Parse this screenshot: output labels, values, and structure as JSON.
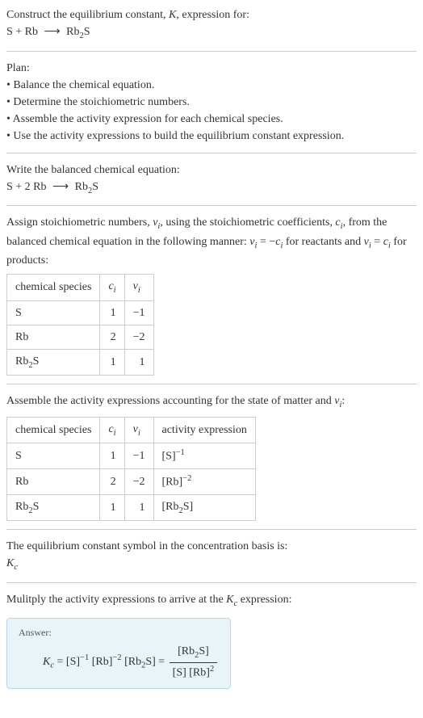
{
  "intro": {
    "line1_prefix": "Construct the equilibrium constant, ",
    "line1_K": "K",
    "line1_suffix": ", expression for:",
    "equation_lhs": "S + Rb",
    "arrow": "⟶",
    "equation_rhs1": "Rb",
    "equation_rhs_sub": "2",
    "equation_rhs2": "S"
  },
  "plan": {
    "title": "Plan:",
    "b1": "• Balance the chemical equation.",
    "b2": "• Determine the stoichiometric numbers.",
    "b3": "• Assemble the activity expression for each chemical species.",
    "b4": "• Use the activity expressions to build the equilibrium constant expression."
  },
  "balanced": {
    "title": "Write the balanced chemical equation:",
    "lhs": "S + 2 Rb",
    "arrow": "⟶",
    "rhs1": "Rb",
    "rhs_sub": "2",
    "rhs2": "S"
  },
  "stoich_text": {
    "p1": "Assign stoichiometric numbers, ",
    "nu": "ν",
    "i": "i",
    "p2": ", using the stoichiometric coefficients, ",
    "c": "c",
    "p3": ", from the balanced chemical equation in the following manner: ",
    "eq_reactants_lhs": "ν",
    "eq_eq": " = −",
    "eq_reactants_c": "c",
    "p4": " for reactants and ",
    "eq_products_lhs": "ν",
    "eq_products_eq": " = ",
    "eq_products_c": "c",
    "p5": " for products:"
  },
  "table1": {
    "h1": "chemical species",
    "h2_c": "c",
    "h2_i": "i",
    "h3_nu": "ν",
    "h3_i": "i",
    "rows": [
      {
        "species": "S",
        "sub": "",
        "c": "1",
        "nu": "−1"
      },
      {
        "species": "Rb",
        "sub": "",
        "c": "2",
        "nu": "−2"
      },
      {
        "species": "Rb",
        "sub": "2",
        "species2": "S",
        "c": "1",
        "nu": "1"
      }
    ]
  },
  "activity_text": {
    "p1": "Assemble the activity expressions accounting for the state of matter and ",
    "nu": "ν",
    "i": "i",
    "p2": ":"
  },
  "table2": {
    "h1": "chemical species",
    "h2_c": "c",
    "h2_i": "i",
    "h3_nu": "ν",
    "h3_i": "i",
    "h4": "activity expression",
    "rows": [
      {
        "species": "S",
        "sub": "",
        "c": "1",
        "nu": "−1",
        "expr_base": "[S]",
        "expr_sup": "−1"
      },
      {
        "species": "Rb",
        "sub": "",
        "c": "2",
        "nu": "−2",
        "expr_base": "[Rb]",
        "expr_sup": "−2"
      },
      {
        "species": "Rb",
        "sub": "2",
        "species2": "S",
        "c": "1",
        "nu": "1",
        "expr_base": "[Rb",
        "expr_inner_sub": "2",
        "expr_tail": "S]",
        "expr_sup": ""
      }
    ]
  },
  "basis": {
    "line": "The equilibrium constant symbol in the concentration basis is:",
    "K": "K",
    "c": "c"
  },
  "multiply": {
    "p1": "Mulitply the activity expressions to arrive at the ",
    "K": "K",
    "c": "c",
    "p2": " expression:"
  },
  "answer": {
    "label": "Answer:",
    "Kc_K": "K",
    "Kc_c": "c",
    "eq": " = ",
    "t1": "[S]",
    "t1_sup": "−1",
    "t2": " [Rb]",
    "t2_sup": "−2",
    "t3_open": " [Rb",
    "t3_sub": "2",
    "t3_close": "S] = ",
    "frac_num_open": "[Rb",
    "frac_num_sub": "2",
    "frac_num_close": "S]",
    "frac_den_1": "[S] [Rb]",
    "frac_den_sup": "2"
  }
}
